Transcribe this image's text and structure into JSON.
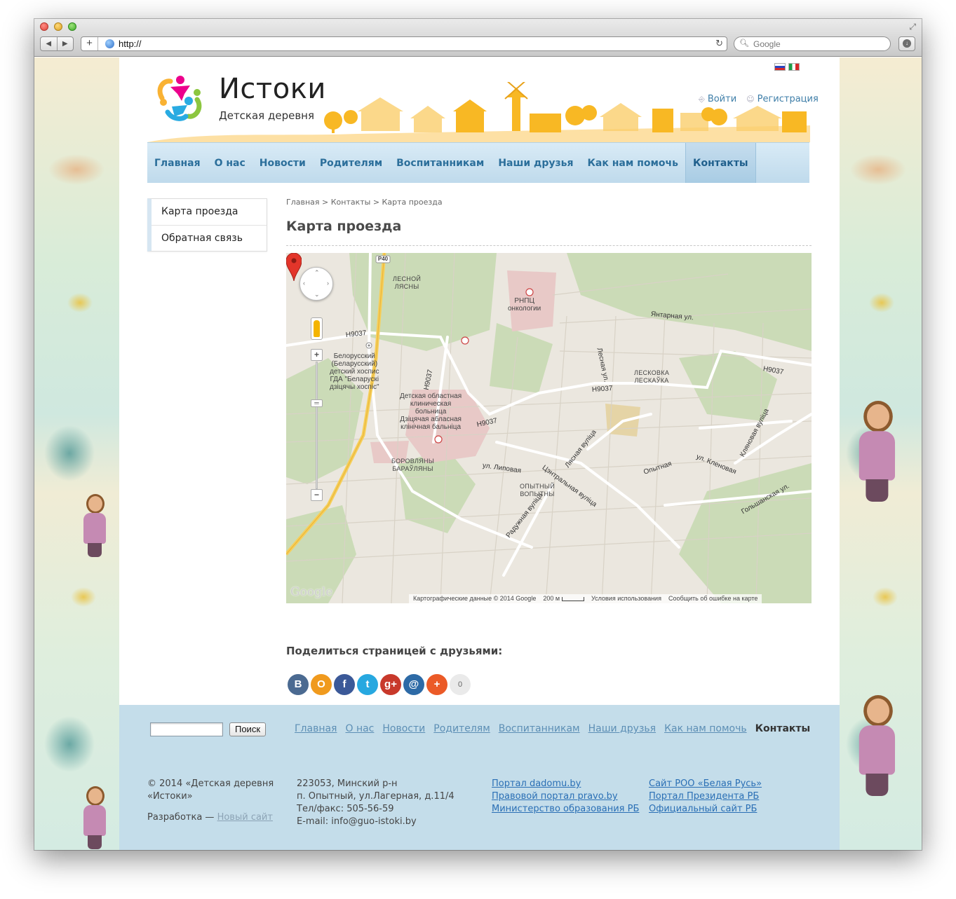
{
  "browser": {
    "url": "http://",
    "search_placeholder": "Google"
  },
  "header": {
    "title": "Истоки",
    "subtitle": "Детская деревня",
    "login": "Войти",
    "register": "Регистрация",
    "languages": [
      "ru",
      "it"
    ]
  },
  "menu": {
    "items": [
      "Главная",
      "О нас",
      "Новости",
      "Родителям",
      "Воспитанникам",
      "Наши друзья",
      "Как нам помочь",
      "Контакты"
    ],
    "active": "Контакты"
  },
  "sidebar": {
    "items": [
      "Карта проезда",
      "Обратная связь"
    ]
  },
  "content": {
    "breadcrumb": "Главная > Контакты > Карта проезда",
    "title": "Карта проезда"
  },
  "map": {
    "labels": {
      "road_p40": "P40",
      "lesnoy": "ЛЕСНОЙ\nЛЯСНЫ",
      "rnpc": "РНПЦ\nонкологии",
      "yantarnaya": "Янтарная ул.",
      "n9037": "Н9037",
      "hospice": "Белорусский\n(Беларусский)\nдетский хоспис\nГДА \"Беларускі\nдзіцячы хоспіс\"",
      "hospital": "Детская областная\nклиническая\nбольница\nДзіцячая абласная\nклінічная бальніца",
      "leskovka": "ЛЕСКОВКА\nЛЕСКАЎКА",
      "lesnaya_ul": "Лесная ул.",
      "lyasnaya": "Лясная вуліца",
      "borovlyany": "БОРОВЛЯНЫ\nБАРАЎЛЯНЫ",
      "lipovaya": "ул. Липовая",
      "tsentralnaya": "Цэнтральная вуліца",
      "opytny": "ОПЫТНЫЙ\nВОПЫТНЫ",
      "opytnaya": "Опытная",
      "klenovaya": "ул. Кленовая",
      "klyanovaya": "Кляновая вуліца",
      "golshanskaya": "Гольшанская ул.",
      "radujnaya": "Радужная вуліца"
    },
    "google": "Google",
    "attribution": "Картографические данные © 2014 Google",
    "scale": "200 м",
    "terms": "Условия использования",
    "report": "Сообщить об ошибке на карте"
  },
  "share": {
    "title": "Поделиться страницей с друзьями:",
    "buttons": [
      {
        "name": "vk",
        "label": "В",
        "color": "#4b6a91"
      },
      {
        "name": "odnoklassniki",
        "label": "О",
        "color": "#f09a1e"
      },
      {
        "name": "facebook",
        "label": "f",
        "color": "#3b5998"
      },
      {
        "name": "twitter",
        "label": "t",
        "color": "#27a8e0"
      },
      {
        "name": "google-plus",
        "label": "g+",
        "color": "#c8392b"
      },
      {
        "name": "mail",
        "label": "@",
        "color": "#2d6aa6"
      },
      {
        "name": "more",
        "label": "+",
        "color": "#eb5a27"
      }
    ],
    "count": "0"
  },
  "footer": {
    "search_button": "Поиск",
    "menu": [
      "Главная",
      "О нас",
      "Новости",
      "Родителям",
      "Воспитанникам",
      "Наши друзья",
      "Как нам помочь",
      "Контакты"
    ],
    "copyright_line1": "© 2014 «Детская деревня",
    "copyright_line2": "«Истоки»",
    "dev_prefix": "Разработка — ",
    "dev_link": "Новый сайт",
    "address": [
      "223053, Минский р-н",
      "п. Опытный, ул.Лагерная, д.11/4",
      "Тел/факс: 505-56-59",
      "E-mail: info@guo-istoki.by"
    ],
    "links_col1": [
      "Портал dadomu.by",
      "Правовой портал pravo.by",
      "Министерство образования РБ"
    ],
    "links_col2": [
      "Сайт РОО «Белая Русь»",
      "Портал Президента РБ",
      "Официальный сайт РБ"
    ]
  },
  "colors": {
    "menu_text": "#2c6f9b",
    "footer_bg": "#c4ddea",
    "link": "#2a6fb5"
  }
}
